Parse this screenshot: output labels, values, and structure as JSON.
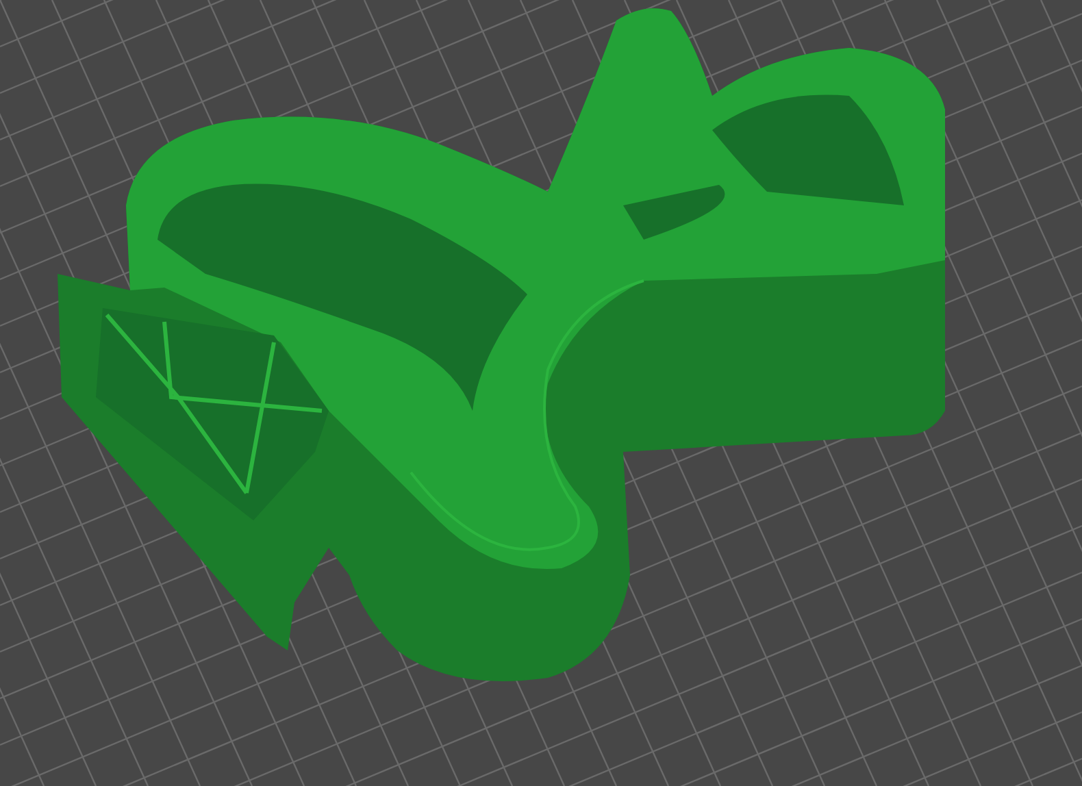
{
  "viewport": {
    "kind": "sliced-model"
  }
}
